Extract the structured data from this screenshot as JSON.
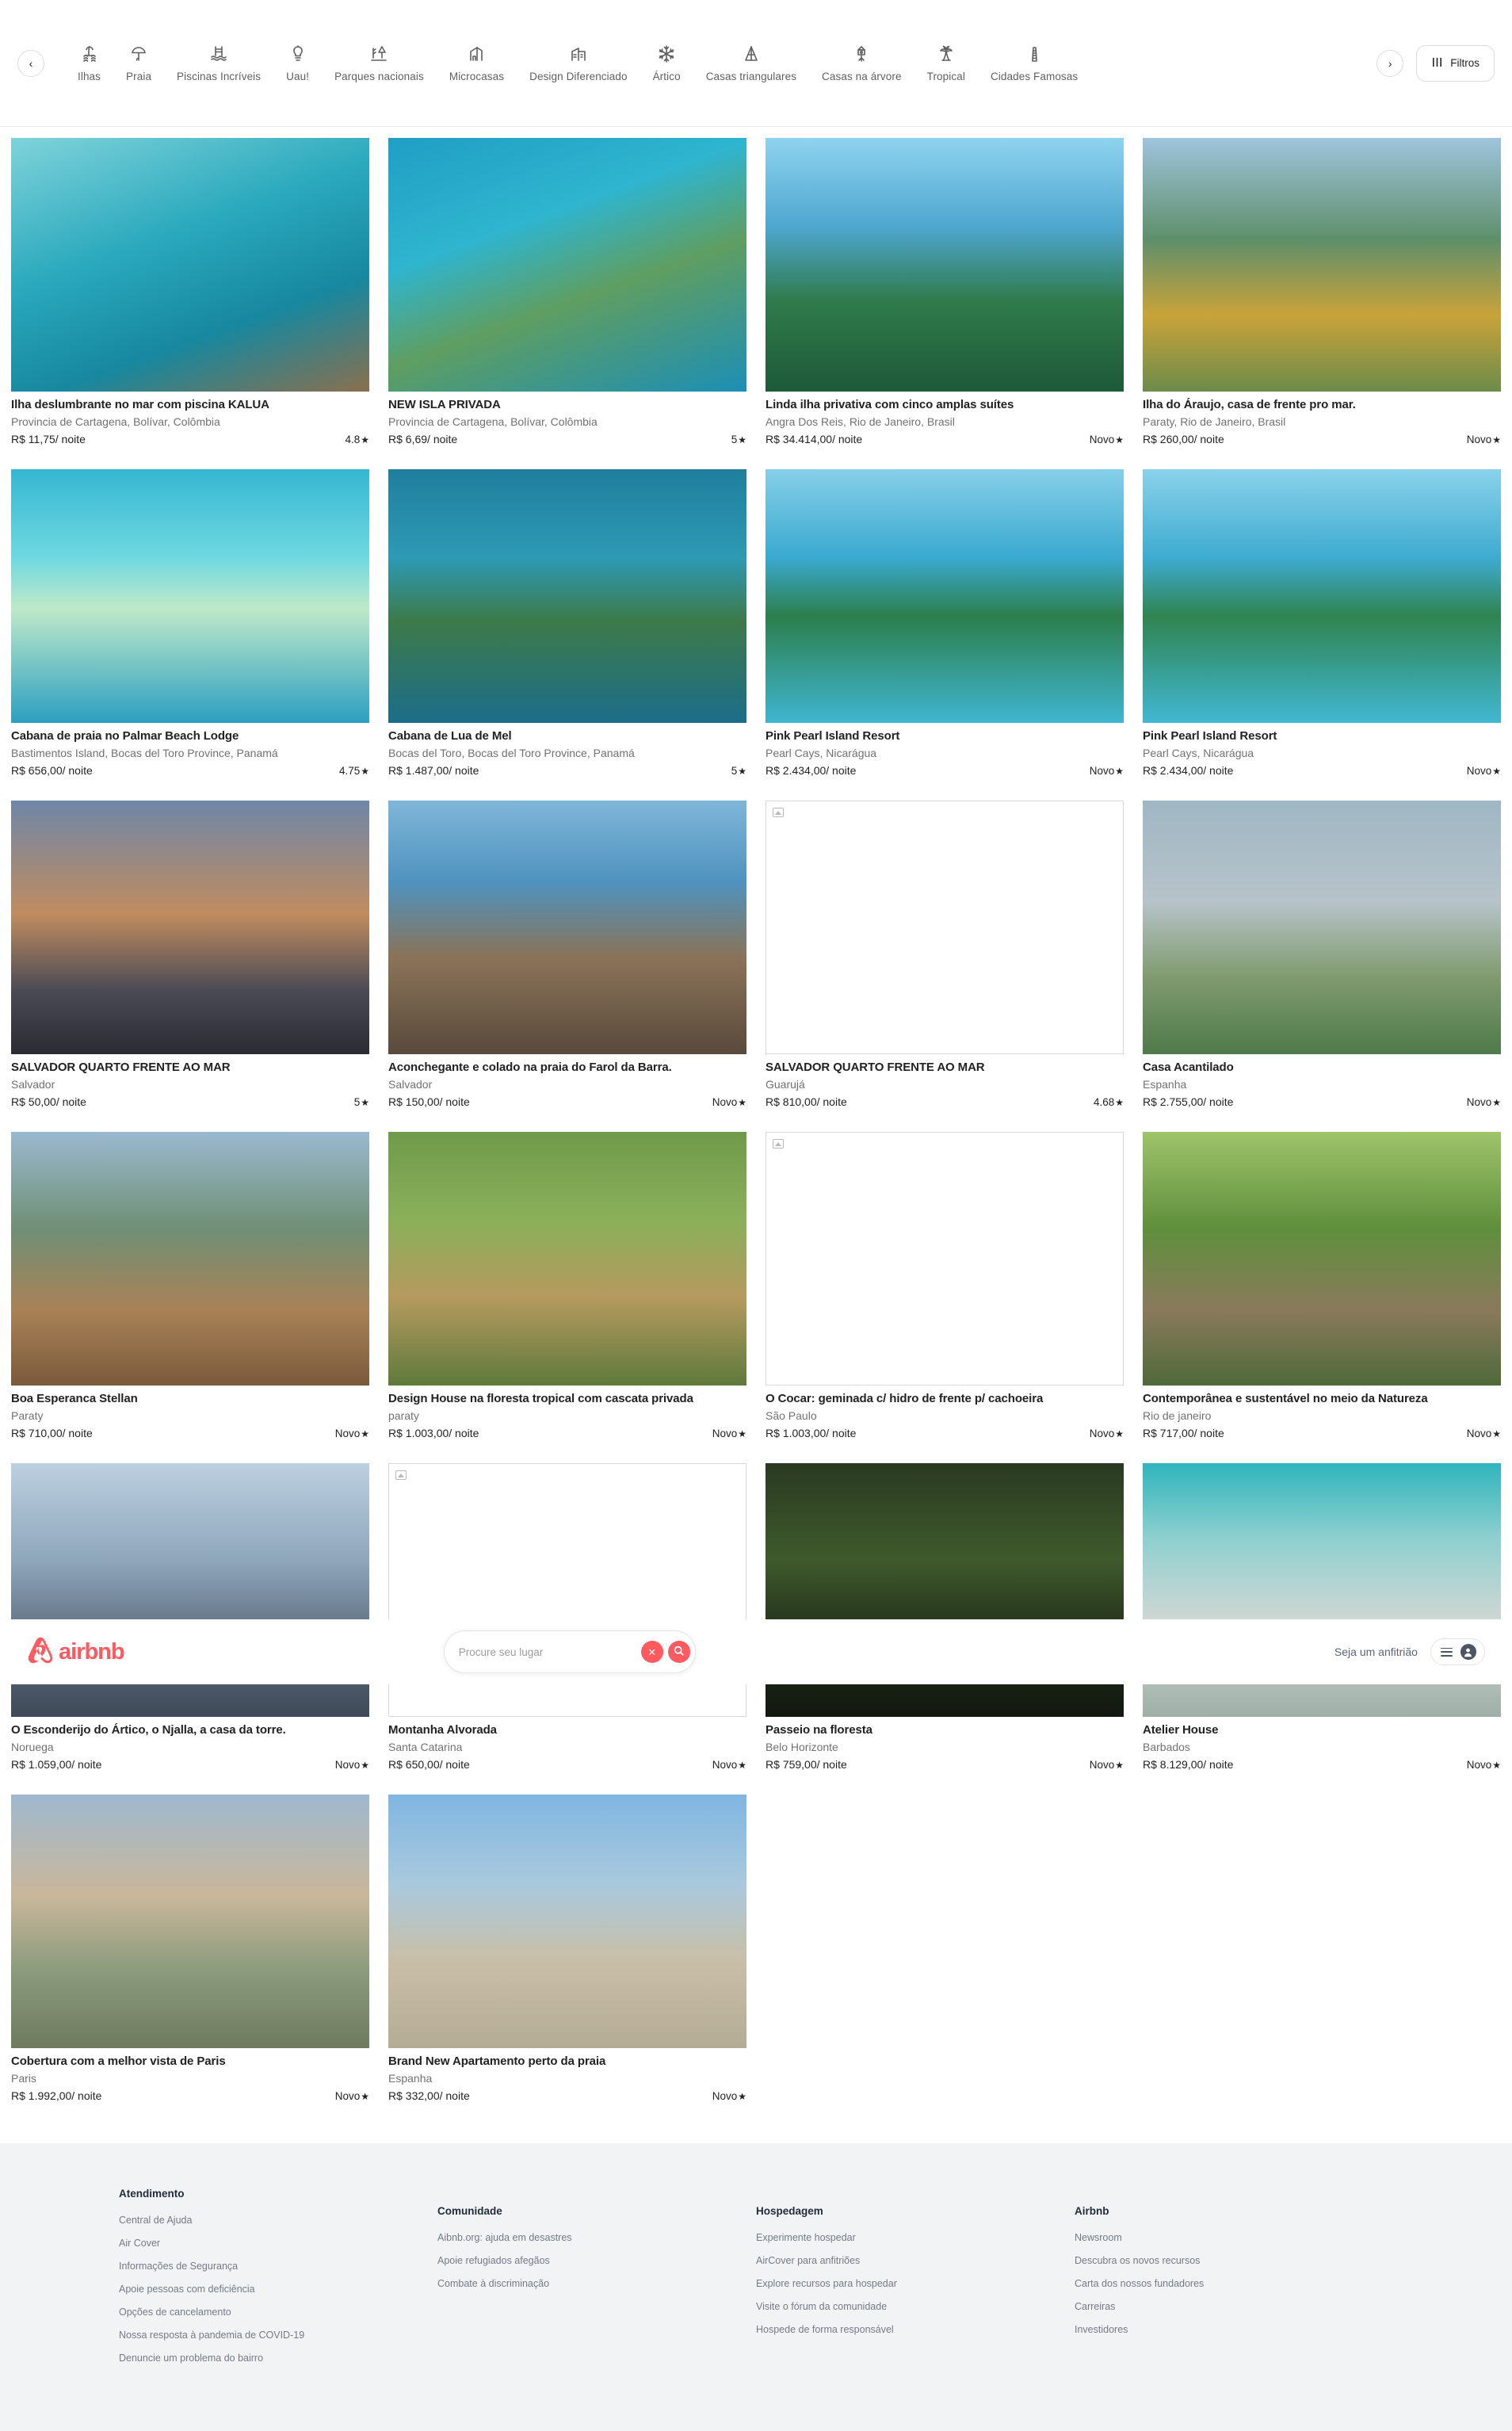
{
  "categorybar": {
    "prev_label": "‹",
    "next_label": "›",
    "filters_label": "Filtros",
    "items": [
      {
        "label": "Ilhas",
        "icon": "island-icon"
      },
      {
        "label": "Praia",
        "icon": "beach-umbrella-icon"
      },
      {
        "label": "Piscinas Incríveis",
        "icon": "pool-icon"
      },
      {
        "label": "Uau!",
        "icon": "wow-icon"
      },
      {
        "label": "Parques nacionais",
        "icon": "national-park-icon"
      },
      {
        "label": "Microcasas",
        "icon": "tiny-home-icon"
      },
      {
        "label": "Design Diferenciado",
        "icon": "design-icon"
      },
      {
        "label": "Ártico",
        "icon": "snowflake-icon"
      },
      {
        "label": "Casas triangulares",
        "icon": "a-frame-icon"
      },
      {
        "label": "Casas na árvore",
        "icon": "treehouse-icon"
      },
      {
        "label": "Tropical",
        "icon": "palm-tree-icon"
      },
      {
        "label": "Cidades Famosas",
        "icon": "tower-icon"
      }
    ]
  },
  "search": {
    "placeholder": "Procure seu lugar",
    "value": "",
    "clear_label": "✕",
    "search_icon": "search-icon",
    "host_link": "Seja um anfitrião",
    "brand": "airbnb",
    "accent_color": "#FF5A5F"
  },
  "listings": [
    {
      "title": "Ilha deslumbrante no mar com piscina KALUA",
      "location": "Provincia de Cartagena, Bolívar, Colômbia",
      "price": "R$ 11,75/ noite",
      "rating": "4.8",
      "image": "island-overwater-villa",
      "has_image": true
    },
    {
      "title": "NEW ISLA PRIVADA",
      "location": "Provincia de Cartagena, Bolívar, Colômbia",
      "price": "R$ 6,69/ noite",
      "rating": "5",
      "image": "private-island-aerial",
      "has_image": true
    },
    {
      "title": "Linda ilha privativa com cinco amplas suítes",
      "location": "Angra Dos Reis, Rio de Janeiro, Brasil",
      "price": "R$ 34.414,00/ noite",
      "rating": "Novo",
      "image": "tropical-palms-beach",
      "has_image": true
    },
    {
      "title": "Ilha do Áraujo, casa de frente pro mar.",
      "location": "Paraty, Rio de Janeiro, Brasil",
      "price": "R$ 260,00/ noite",
      "rating": "Novo",
      "image": "yellow-beach-house",
      "has_image": true
    },
    {
      "title": "Cabana de praia no Palmar Beach Lodge",
      "location": "Bastimentos Island, Bocas del Toro Province, Panamá",
      "price": "R$ 656,00/ noite",
      "rating": "4.75",
      "image": "aerial-island-reef",
      "has_image": true
    },
    {
      "title": "Cabana de Lua de Mel",
      "location": "Bocas del Toro, Bocas del Toro Province, Panamá",
      "price": "R$ 1.487,00/ noite",
      "rating": "5",
      "image": "mangrove-islands",
      "has_image": true
    },
    {
      "title": "Pink Pearl Island Resort",
      "location": "Pearl Cays, Nicarágua",
      "price": "R$ 2.434,00/ noite",
      "rating": "Novo",
      "image": "pink-pearl-island",
      "has_image": true
    },
    {
      "title": "Pink Pearl Island Resort",
      "location": "Pearl Cays, Nicarágua",
      "price": "R$ 2.434,00/ noite",
      "rating": "Novo",
      "image": "pink-pearl-island-2",
      "has_image": true
    },
    {
      "title": "SALVADOR QUARTO FRENTE AO MAR",
      "location": "Salvador",
      "price": "R$ 50,00/ noite",
      "rating": "5",
      "image": "salvador-seafront-road",
      "has_image": true
    },
    {
      "title": "Aconchegante e colado na praia do Farol da Barra.",
      "location": "Salvador",
      "price": "R$ 150,00/ noite",
      "rating": "Novo",
      "image": "farol-da-barra-lighthouse",
      "has_image": true
    },
    {
      "title": "SALVADOR QUARTO FRENTE AO MAR",
      "location": "Guarujá",
      "price": "R$ 810,00/ noite",
      "rating": "4.68",
      "image": "broken-image",
      "has_image": false
    },
    {
      "title": "Casa Acantilado",
      "location": "Espanha",
      "price": "R$ 2.755,00/ noite",
      "rating": "Novo",
      "image": "cliff-house-scales",
      "has_image": true
    },
    {
      "title": "Boa Esperanca Stellan",
      "location": "Paraty",
      "price": "R$ 710,00/ noite",
      "rating": "Novo",
      "image": "deck-hammock-view",
      "has_image": true
    },
    {
      "title": "Design House na floresta tropical com cascata privada",
      "location": "paraty",
      "price": "R$ 1.003,00/ noite",
      "rating": "Novo",
      "image": "a-frame-forest-house",
      "has_image": true
    },
    {
      "title": "O Cocar: geminada c/ hidro de frente p/ cachoeira",
      "location": "São Paulo",
      "price": "R$ 1.003,00/ noite",
      "rating": "Novo",
      "image": "broken-image",
      "has_image": false
    },
    {
      "title": "Contemporânea e sustentável no meio da Natureza",
      "location": "Rio de janeiro",
      "price": "R$ 717,00/ noite",
      "rating": "Novo",
      "image": "glass-house-jungle",
      "has_image": true
    },
    {
      "title": "O Esconderijo do Ártico, o Njalla, a casa da torre.",
      "location": "Noruega",
      "price": "R$ 1.059,00/ noite",
      "rating": "Novo",
      "image": "arctic-tower-cabin",
      "has_image": true
    },
    {
      "title": "Montanha Alvorada",
      "location": "Santa Catarina",
      "price": "R$ 650,00/ noite",
      "rating": "Novo",
      "image": "broken-image",
      "has_image": false
    },
    {
      "title": "Passeio na floresta",
      "location": "Belo Horizonte",
      "price": "R$ 759,00/ noite",
      "rating": "Novo",
      "image": "forest-tent-dome",
      "has_image": true
    },
    {
      "title": "Atelier House",
      "location": "Barbados",
      "price": "R$ 8.129,00/ noite",
      "rating": "Novo",
      "image": "modern-pool-villa",
      "has_image": true
    },
    {
      "title": "Cobertura com a melhor vista de Paris",
      "location": "Paris",
      "price": "R$ 1.992,00/ noite",
      "rating": "Novo",
      "image": "paris-eiffel-terrace",
      "has_image": true
    },
    {
      "title": "Brand New Apartamento perto da praia",
      "location": "Espanha",
      "price": "R$ 332,00/ noite",
      "rating": "Novo",
      "image": "castle-spain",
      "has_image": true
    }
  ],
  "footer": {
    "columns": [
      {
        "heading": "Atendimento",
        "links": [
          "Central de Ajuda",
          "Air Cover",
          "Informações de Segurança",
          "Apoie pessoas com deficiência",
          "Opções de cancelamento",
          "Nossa resposta à pandemia de COVID-19",
          "Denuncie um problema do bairro"
        ]
      },
      {
        "heading": "Comunidade",
        "links": [
          "Aibnb.org: ajuda em desastres",
          "Apoie refugiados afegãos",
          "Combate à discriminação"
        ]
      },
      {
        "heading": "Hospedagem",
        "links": [
          "Experimente hospedar",
          "AirCover para anfitriões",
          "Explore recursos para hospedar",
          "Visite o fórum da comunidade",
          "Hospede de forma responsável"
        ]
      },
      {
        "heading": "Airbnb",
        "links": [
          "Newsroom",
          "Descubra os novos recursos",
          "Carta dos nossos fundadores",
          "Carreiras",
          "Investidores"
        ]
      }
    ]
  }
}
